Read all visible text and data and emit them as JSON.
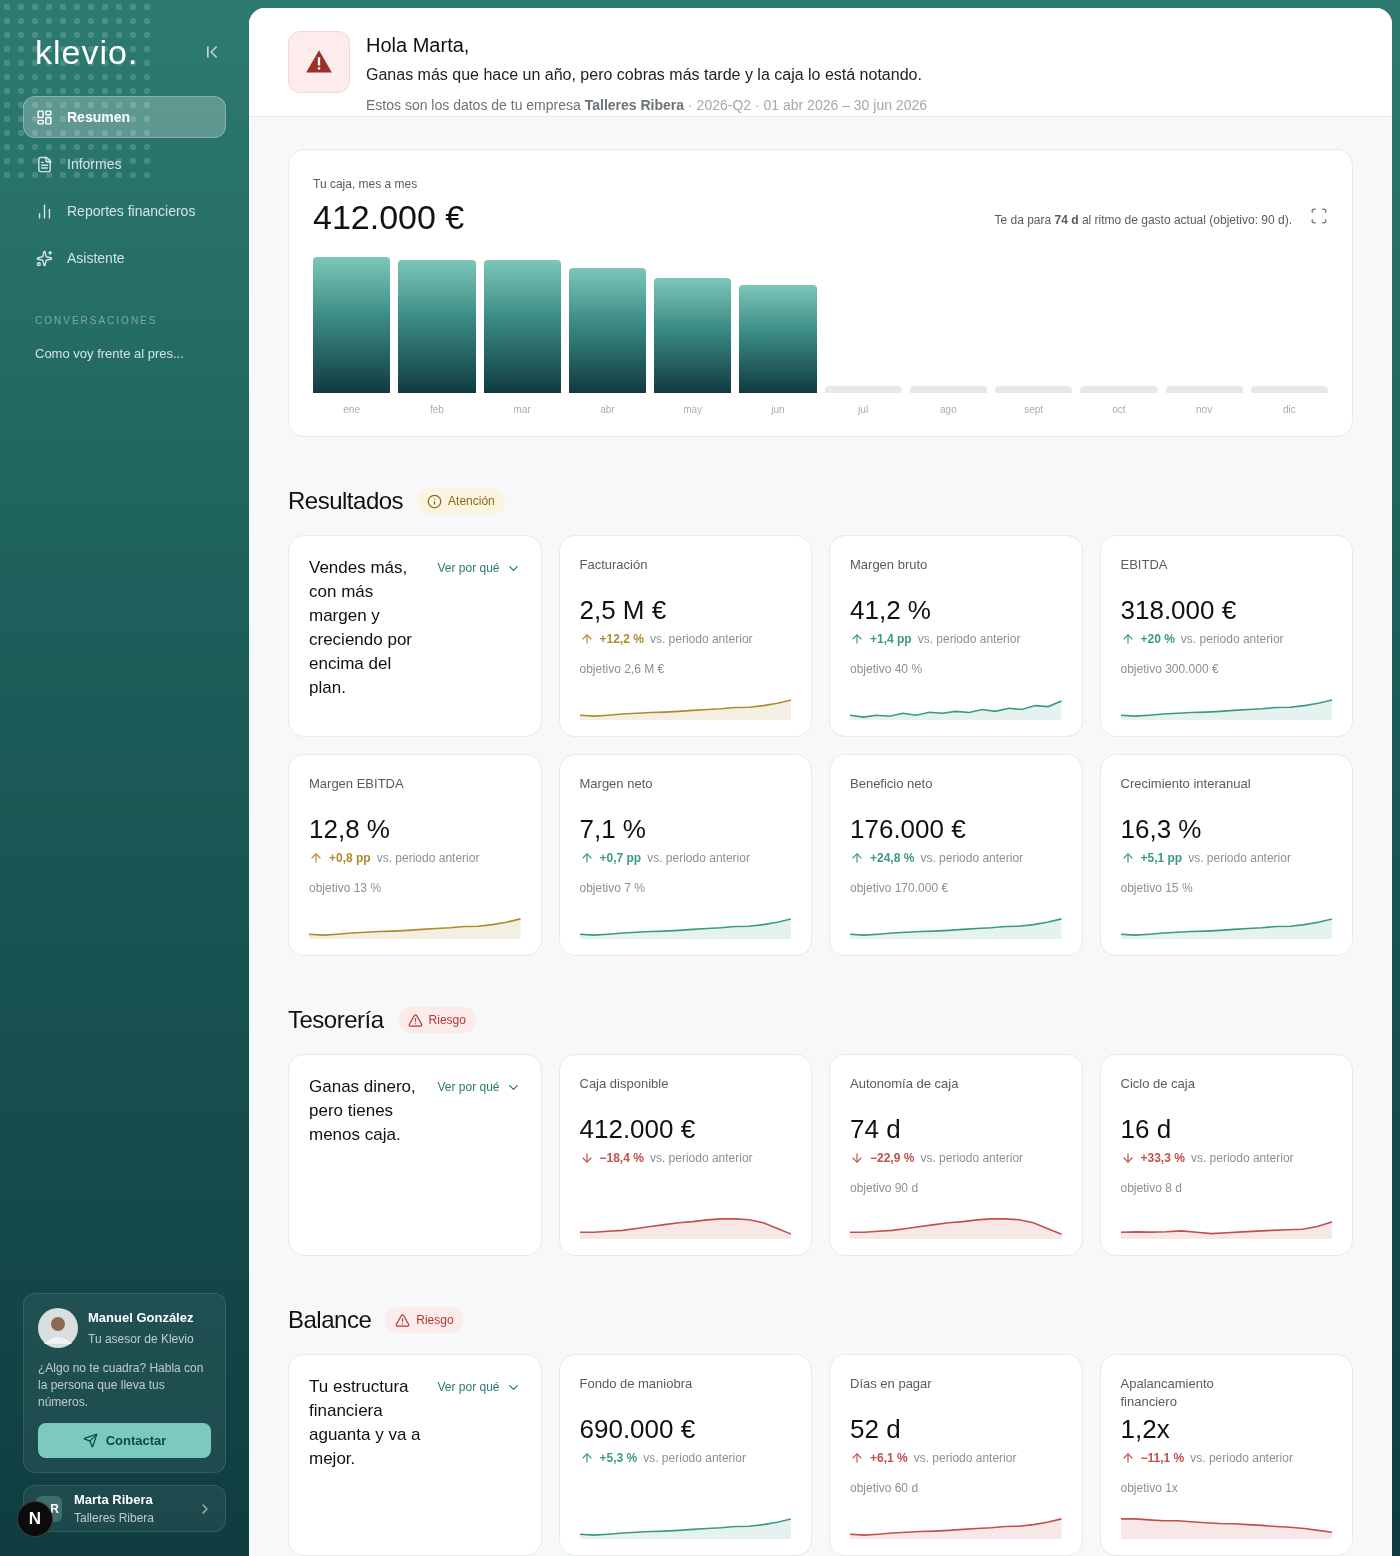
{
  "sidebar": {
    "logo": "klevio.",
    "nav": [
      {
        "label": "Resumen",
        "selected": true
      },
      {
        "label": "Informes",
        "selected": false
      },
      {
        "label": "Reportes financieros",
        "selected": false
      },
      {
        "label": "Asistente",
        "selected": false
      }
    ],
    "conversations_heading": "CONVERSACIONES",
    "conversations": [
      "Como voy frente al pres..."
    ],
    "advisor": {
      "name": "Manuel González",
      "role": "Tu asesor de Klevio",
      "message": "¿Algo no te cuadra? Habla con la persona que lleva tus números.",
      "button": "Contactar"
    },
    "user": {
      "initials": "R",
      "name": "Marta Ribera",
      "company": "Talleres Ribera"
    },
    "dev_badge": "N"
  },
  "header": {
    "greeting": "Hola Marta,",
    "message": "Ganas más que hace un año, pero cobras más tarde y la caja lo está notando.",
    "meta": "Estos son los datos de tu empresa **Talleres Ribera**",
    "period": "· 2026-Q2 · 01 abr 2026 – 30 jun 2026"
  },
  "cash": {
    "label": "Tu caja, mes a mes",
    "amount": "412.000 €",
    "note": "Te da para **74 d** al ritmo de gasto actual (objetivo: 90 d).",
    "months": [
      {
        "label": "ene",
        "has_data": true
      },
      {
        "label": "feb",
        "has_data": true
      },
      {
        "label": "mar",
        "has_data": true
      },
      {
        "label": "abr",
        "has_data": true
      },
      {
        "label": "may",
        "has_data": true
      },
      {
        "label": "jun",
        "has_data": true
      },
      {
        "label": "jul",
        "has_data": false
      },
      {
        "label": "ago",
        "has_data": false
      },
      {
        "label": "sept",
        "has_data": false
      },
      {
        "label": "oct",
        "has_data": false
      },
      {
        "label": "nov",
        "has_data": false
      },
      {
        "label": "dic",
        "has_data": false
      }
    ]
  },
  "sections": [
    {
      "title": "Resultados",
      "badge": {
        "kind": "attention",
        "label": "Atención"
      },
      "summary": {
        "text": "Vendes más, con más margen y creciendo por encima del plan.",
        "link": "Ver por qué"
      },
      "metrics": [
        {
          "title": "Facturación",
          "value": "2,5 M €",
          "delta": "+12,2 %",
          "delta_note": "vs. periodo anterior",
          "rising": true,
          "color": "#b08a2e",
          "target": "objetivo 2,6 M €"
        },
        {
          "title": "Margen bruto",
          "value": "41,2 %",
          "delta": "+1,4 pp",
          "delta_note": "vs. periodo anterior",
          "rising": true,
          "color": "#3a9a85",
          "target": "objetivo 40 %"
        },
        {
          "title": "EBITDA",
          "value": "318.000 €",
          "delta": "+20 %",
          "delta_note": "vs. periodo anterior",
          "rising": true,
          "color": "#3a9a85",
          "target": "objetivo 300.000 €"
        },
        {
          "title": "Margen EBITDA",
          "value": "12,8 %",
          "delta": "+0,8 pp",
          "delta_note": "vs. periodo anterior",
          "rising": true,
          "color": "#b08a2e",
          "target": "objetivo 13 %"
        },
        {
          "title": "Margen neto",
          "value": "7,1 %",
          "delta": "+0,7 pp",
          "delta_note": "vs. periodo anterior",
          "rising": true,
          "color": "#3a9a85",
          "target": "objetivo 7 %"
        },
        {
          "title": "Beneficio neto",
          "value": "176.000 €",
          "delta": "+24,8 %",
          "delta_note": "vs. periodo anterior",
          "rising": true,
          "color": "#3a9a85",
          "target": "objetivo 170.000 €"
        },
        {
          "title": "Crecimiento interanual",
          "value": "16,3 %",
          "delta": "+5,1 pp",
          "delta_note": "vs. periodo anterior",
          "rising": true,
          "color": "#3a9a85",
          "target": "objetivo 15 %"
        }
      ]
    },
    {
      "title": "Tesorería",
      "badge": {
        "kind": "risk",
        "label": "Riesgo"
      },
      "summary": {
        "text": "Ganas dinero, pero tienes menos caja.",
        "link": "Ver por qué"
      },
      "metrics": [
        {
          "title": "Caja disponible",
          "value": "412.000 €",
          "delta": "−18,4 %",
          "delta_note": "vs. periodo anterior",
          "rising": false,
          "color": "#c0504d"
        },
        {
          "title": "Autonomía de caja",
          "value": "74 d",
          "delta": "−22,9 %",
          "delta_note": "vs. periodo anterior",
          "rising": false,
          "color": "#c0504d",
          "target": "objetivo 90 d"
        },
        {
          "title": "Ciclo de caja",
          "value": "16 d",
          "delta": "+33,3 %",
          "delta_note": "vs. periodo anterior",
          "rising": false,
          "color": "#c0504d",
          "target": "objetivo 8 d"
        }
      ]
    },
    {
      "title": "Balance",
      "badge": {
        "kind": "risk",
        "label": "Riesgo"
      },
      "summary": {
        "text": "Tu estructura financiera aguanta y va a mejor.",
        "link": "Ver por qué"
      },
      "metrics": [
        {
          "title": "Fondo de maniobra",
          "value": "690.000 €",
          "delta": "+5,3 %",
          "delta_note": "vs. periodo anterior",
          "rising": true,
          "color": "#3a9a85"
        },
        {
          "title": "Días en pagar",
          "value": "52 d",
          "delta": "+6,1 %",
          "delta_note": "vs. periodo anterior",
          "rising": true,
          "color": "#c0504d",
          "target": "objetivo 60 d"
        },
        {
          "title": "Apalancamiento financiero",
          "value": "1,2x",
          "delta": "−11,1 %",
          "delta_note": "vs. periodo anterior",
          "rising": true,
          "color": "#c0504d",
          "target": "objetivo 1x"
        }
      ]
    }
  ]
}
